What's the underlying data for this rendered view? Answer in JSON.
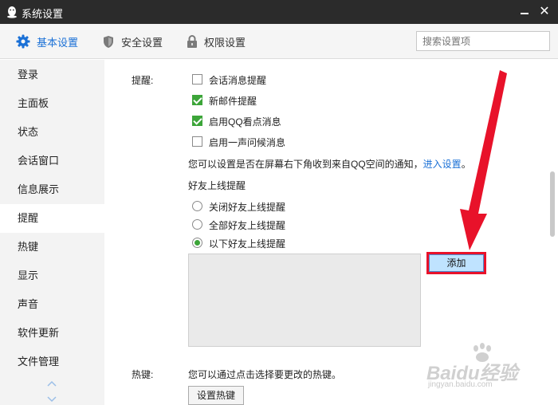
{
  "window": {
    "title": "系统设置"
  },
  "tabs": [
    {
      "label": "基本设置",
      "icon": "gear-icon",
      "active": true
    },
    {
      "label": "安全设置",
      "icon": "shield-icon",
      "active": false
    },
    {
      "label": "权限设置",
      "icon": "lock-icon",
      "active": false
    }
  ],
  "search": {
    "placeholder": "搜索设置项"
  },
  "sidebar": {
    "items": [
      {
        "label": "登录"
      },
      {
        "label": "主面板"
      },
      {
        "label": "状态"
      },
      {
        "label": "会话窗口"
      },
      {
        "label": "信息展示"
      },
      {
        "label": "提醒",
        "active": true
      },
      {
        "label": "热键"
      },
      {
        "label": "显示"
      },
      {
        "label": "声音"
      },
      {
        "label": "软件更新"
      },
      {
        "label": "文件管理"
      }
    ]
  },
  "reminders": {
    "section_label": "提醒:",
    "options": [
      {
        "label": "会话消息提醒",
        "checked": false
      },
      {
        "label": "新邮件提醒",
        "checked": true
      },
      {
        "label": "启用QQ看点消息",
        "checked": true
      },
      {
        "label": "启用一声问候消息",
        "checked": false
      }
    ],
    "note_text": "您可以设置是否在屏幕右下角收到来自QQ空间的通知，",
    "note_link": "进入设置",
    "note_end": "。",
    "friend_online_title": "好友上线提醒",
    "friend_online_options": [
      {
        "label": "关闭好友上线提醒",
        "selected": false
      },
      {
        "label": "全部好友上线提醒",
        "selected": false
      },
      {
        "label": "以下好友上线提醒",
        "selected": true
      }
    ],
    "add_button": "添加"
  },
  "hotkeys": {
    "section_label": "热键:",
    "description": "您可以通过点击选择要更改的热键。",
    "button": "设置热键"
  },
  "watermark": {
    "brand": "Baidu经验",
    "url": "jingyan.baidu.com"
  },
  "colors": {
    "accent": "#1a70d6",
    "check_green": "#3ca539",
    "highlight_red": "#e8122a",
    "titlebar": "#2b2b2b"
  }
}
